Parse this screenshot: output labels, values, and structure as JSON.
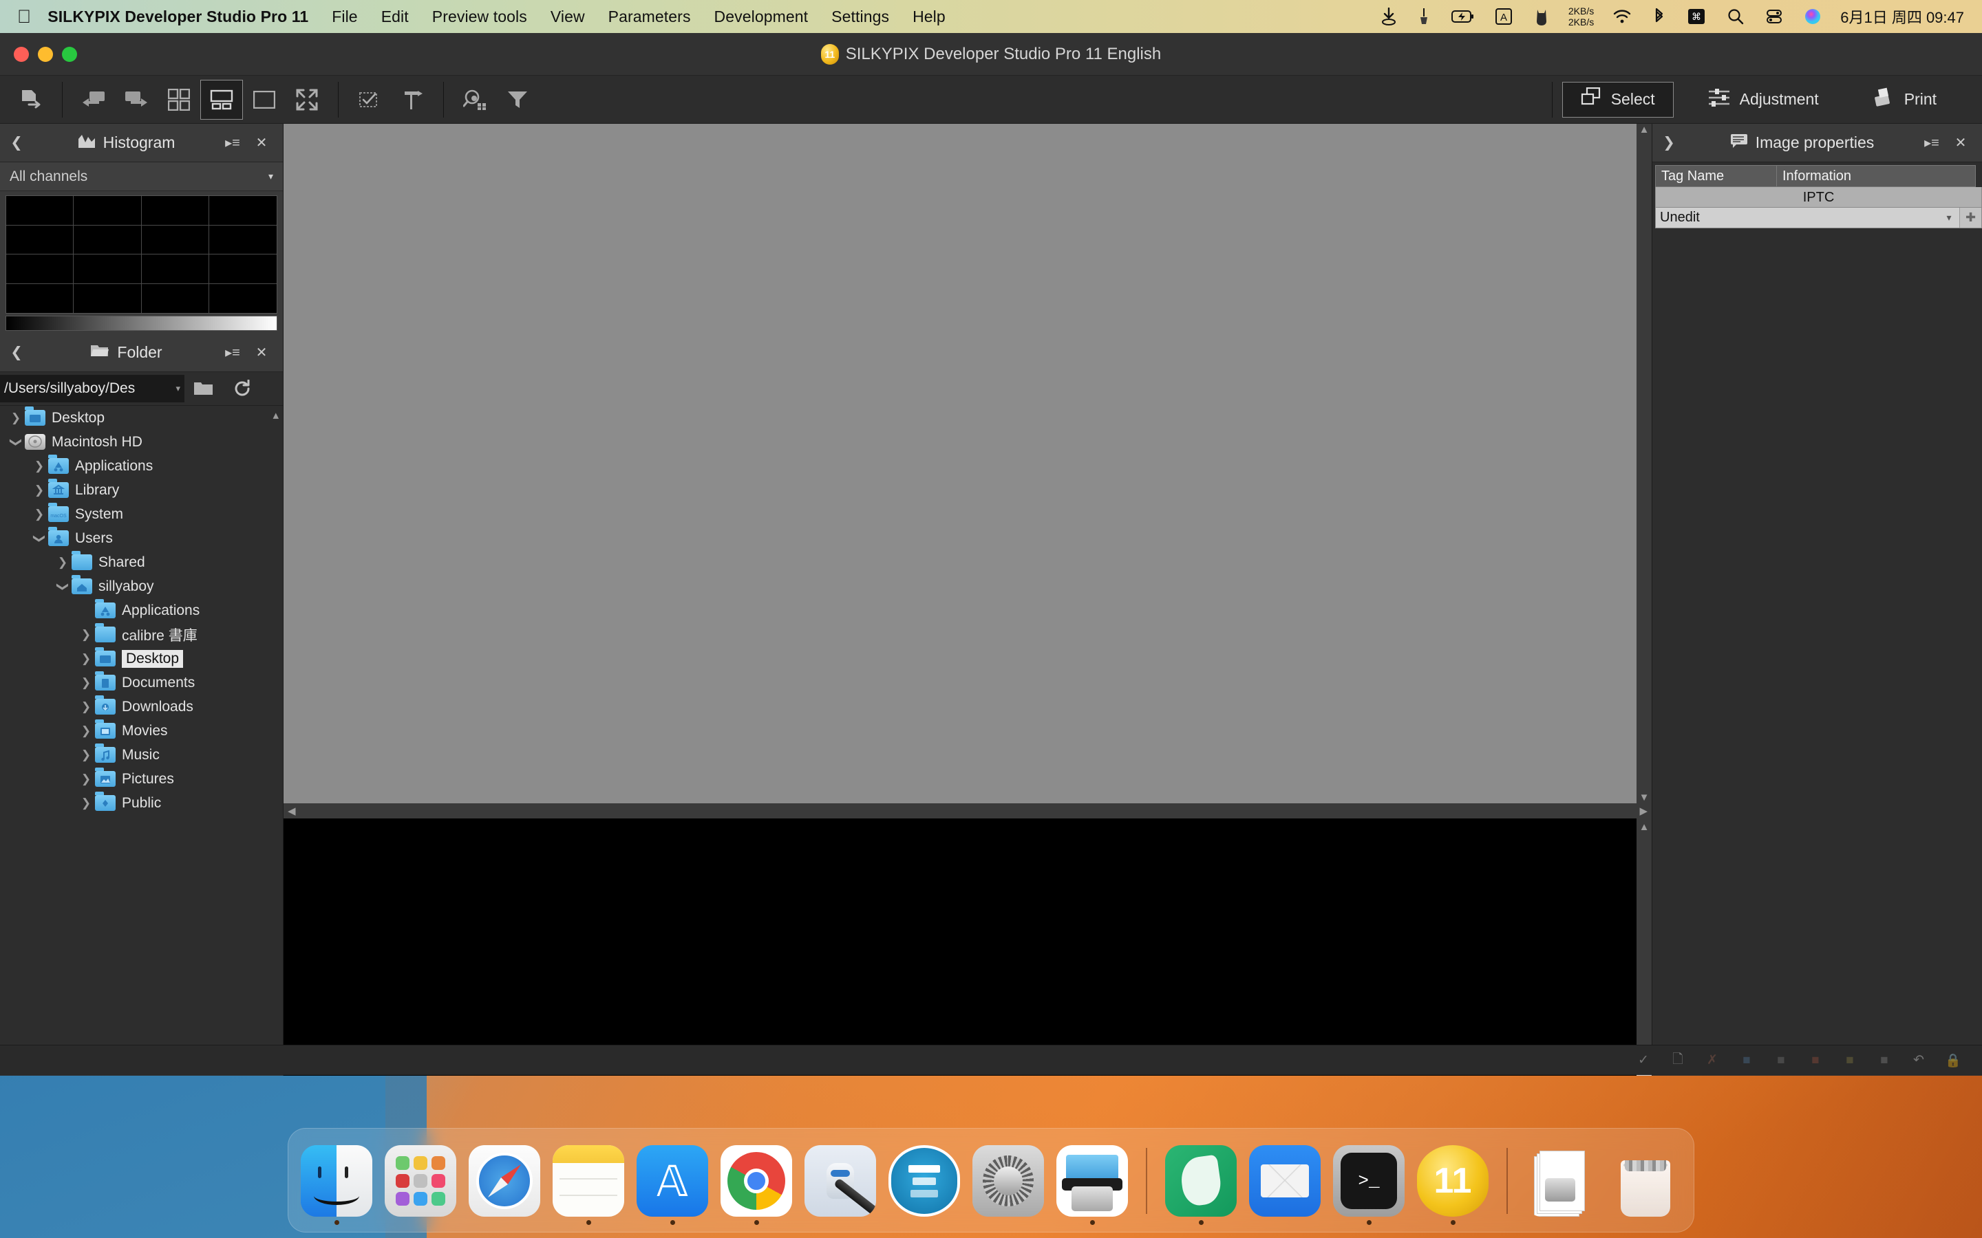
{
  "menubar": {
    "apple_icon": "apple-logo-icon",
    "app_name": "SILKYPIX Developer Studio Pro 11",
    "items": [
      "File",
      "Edit",
      "Preview tools",
      "View",
      "Parameters",
      "Development",
      "Settings",
      "Help"
    ],
    "extras": [
      {
        "name": "download-arrow-icon"
      },
      {
        "name": "cleaner-brush-icon"
      },
      {
        "name": "battery-charging-icon"
      },
      {
        "name": "input-source-a-icon"
      },
      {
        "name": "cat-silhouette-icon"
      }
    ],
    "network_speed": {
      "up": "2KB/s",
      "down": "2KB/s"
    },
    "right_icons": [
      {
        "name": "wifi-icon"
      },
      {
        "name": "bluetooth-icon"
      },
      {
        "name": "command-key-icon"
      },
      {
        "name": "spotlight-search-icon"
      },
      {
        "name": "control-center-icon"
      },
      {
        "name": "siri-icon"
      }
    ],
    "clock": "6月1日 周四  09:47"
  },
  "window": {
    "title": "SILKYPIX Developer Studio Pro 11 English",
    "logo_text": "11",
    "traffic_lights": [
      "close-button",
      "minimize-button",
      "zoom-button"
    ]
  },
  "toolbar": {
    "left_buttons": [
      {
        "name": "export-image-icon",
        "glyph": "page-arrow"
      }
    ],
    "nav_buttons": [
      {
        "name": "previous-image-icon",
        "glyph": "screen-left-arrow"
      },
      {
        "name": "next-image-icon",
        "glyph": "screen-right-arrow"
      },
      {
        "name": "thumbnail-grid-view-icon",
        "glyph": "grid-4"
      },
      {
        "name": "combined-view-icon",
        "glyph": "preview-filmstrip",
        "active": true
      },
      {
        "name": "single-view-icon",
        "glyph": "square"
      },
      {
        "name": "fullscreen-icon",
        "glyph": "expand-arrows"
      }
    ],
    "mark_buttons": [
      {
        "name": "select-checkbox-icon",
        "glyph": "checkbox"
      },
      {
        "name": "apply-taste-icon",
        "glyph": "hammer-arrow"
      }
    ],
    "search_buttons": [
      {
        "name": "search-images-icon",
        "glyph": "magnifier-grid"
      },
      {
        "name": "filter-icon",
        "glyph": "funnel"
      }
    ],
    "modes": [
      {
        "name": "select-mode-button",
        "label": "Select",
        "icon": "overlapping-squares-icon",
        "active": true
      },
      {
        "name": "adjustment-mode-button",
        "label": "Adjustment",
        "icon": "sliders-icon",
        "active": false
      },
      {
        "name": "print-mode-button",
        "label": "Print",
        "icon": "printer-icon",
        "active": false
      }
    ]
  },
  "histogram_panel": {
    "title": "Histogram",
    "icon": "histogram-icon",
    "collapse_icon": "chevron-left-icon",
    "menu_icon": "panel-menu-icon",
    "close_icon": "close-icon",
    "channel_select": "All channels",
    "grid_columns": 4,
    "grid_rows": 4
  },
  "folder_panel": {
    "title": "Folder",
    "icon": "folder-open-icon",
    "collapse_icon": "chevron-left-icon",
    "menu_icon": "panel-menu-icon",
    "close_icon": "close-icon",
    "path_value": "/Users/sillyaboy/Des",
    "path_placeholder": "/Users/sillyaboy/Desktop",
    "browse_icon": "folder-browse-icon",
    "refresh_icon": "refresh-icon",
    "tree": [
      {
        "label": "Desktop",
        "indent": 0,
        "twisty": "collapsed",
        "icon": "desktop-folder-icon",
        "selected": false
      },
      {
        "label": "Macintosh HD",
        "indent": 0,
        "twisty": "expanded",
        "icon": "hard-disk-icon",
        "selected": false
      },
      {
        "label": "Applications",
        "indent": 1,
        "twisty": "collapsed",
        "icon": "applications-folder-icon",
        "selected": false
      },
      {
        "label": "Library",
        "indent": 1,
        "twisty": "collapsed",
        "icon": "library-folder-icon",
        "selected": false
      },
      {
        "label": "System",
        "indent": 1,
        "twisty": "collapsed",
        "icon": "system-folder-icon",
        "selected": false
      },
      {
        "label": "Users",
        "indent": 1,
        "twisty": "expanded",
        "icon": "users-folder-icon",
        "selected": false
      },
      {
        "label": "Shared",
        "indent": 2,
        "twisty": "collapsed",
        "icon": "folder-icon",
        "selected": false
      },
      {
        "label": "sillyaboy",
        "indent": 2,
        "twisty": "expanded",
        "icon": "home-folder-icon",
        "selected": false
      },
      {
        "label": "Applications",
        "indent": 3,
        "twisty": "none",
        "icon": "applications-folder-icon",
        "selected": false
      },
      {
        "label": "calibre 書庫",
        "indent": 3,
        "twisty": "collapsed",
        "icon": "folder-icon",
        "selected": false
      },
      {
        "label": "Desktop",
        "indent": 3,
        "twisty": "collapsed",
        "icon": "desktop-folder-icon",
        "selected": true
      },
      {
        "label": "Documents",
        "indent": 3,
        "twisty": "collapsed",
        "icon": "documents-folder-icon",
        "selected": false
      },
      {
        "label": "Downloads",
        "indent": 3,
        "twisty": "collapsed",
        "icon": "downloads-folder-icon",
        "selected": false
      },
      {
        "label": "Movies",
        "indent": 3,
        "twisty": "collapsed",
        "icon": "movies-folder-icon",
        "selected": false
      },
      {
        "label": "Music",
        "indent": 3,
        "twisty": "collapsed",
        "icon": "music-folder-icon",
        "selected": false
      },
      {
        "label": "Pictures",
        "indent": 3,
        "twisty": "collapsed",
        "icon": "pictures-folder-icon",
        "selected": false
      },
      {
        "label": "Public",
        "indent": 3,
        "twisty": "collapsed",
        "icon": "public-folder-icon",
        "selected": false
      }
    ]
  },
  "image_properties_panel": {
    "title": "Image properties",
    "icon": "properties-icon",
    "collapse_icon": "chevron-right-icon",
    "menu_icon": "panel-menu-icon",
    "close_icon": "close-icon",
    "columns": [
      "Tag Name",
      "Information"
    ],
    "section": "IPTC",
    "rows": [
      {
        "value": "Unedit",
        "has_dropdown": true,
        "has_add": true
      }
    ]
  },
  "preview": {
    "background_color": "#8c8c8c",
    "filmstrip_color": "#000000",
    "focus_badge_icon": "focus-point-icon",
    "scroll_up_icon": "chevron-up-icon",
    "scroll_down_icon": "chevron-down-icon",
    "scroll_left_icon": "chevron-left-icon",
    "scroll_right_icon": "chevron-right-icon"
  },
  "statusbar": {
    "icons": [
      {
        "name": "check-mark-icon"
      },
      {
        "name": "copy-icon"
      },
      {
        "name": "delete-x-icon"
      },
      {
        "name": "rating-blue-icon"
      },
      {
        "name": "rating-gray-icon"
      },
      {
        "name": "rating-red-icon"
      },
      {
        "name": "rating-yellow-icon"
      },
      {
        "name": "rating-white-icon"
      },
      {
        "name": "undo-icon"
      },
      {
        "name": "lock-icon"
      }
    ]
  },
  "dock": {
    "items": [
      {
        "name": "dock-finder",
        "label": "Finder",
        "running": true
      },
      {
        "name": "dock-launchpad",
        "label": "Launchpad",
        "running": false
      },
      {
        "name": "dock-safari",
        "label": "Safari",
        "running": false
      },
      {
        "name": "dock-notes",
        "label": "Notes",
        "running": true
      },
      {
        "name": "dock-app-store",
        "label": "App Store",
        "running": true
      },
      {
        "name": "dock-chrome",
        "label": "Google Chrome",
        "running": true
      },
      {
        "name": "dock-automator",
        "label": "Automator",
        "running": false
      },
      {
        "name": "dock-mweb",
        "label": "MWeb",
        "running": false
      },
      {
        "name": "dock-system-preferences",
        "label": "System Preferences",
        "running": false
      },
      {
        "name": "dock-image-capture",
        "label": "Image Capture",
        "running": true
      },
      {
        "name": "dock-silkypix-green",
        "label": "SILKYPIX",
        "running": true
      },
      {
        "name": "dock-mail",
        "label": "Mail",
        "running": false
      },
      {
        "name": "dock-terminal",
        "label": "Terminal",
        "running": true
      },
      {
        "name": "dock-silkypix-11",
        "label": "SILKYPIX Developer Studio Pro 11",
        "running": true
      }
    ],
    "stack_items": [
      {
        "name": "dock-documents-stack",
        "label": "Documents"
      },
      {
        "name": "dock-trash",
        "label": "Trash"
      }
    ]
  }
}
